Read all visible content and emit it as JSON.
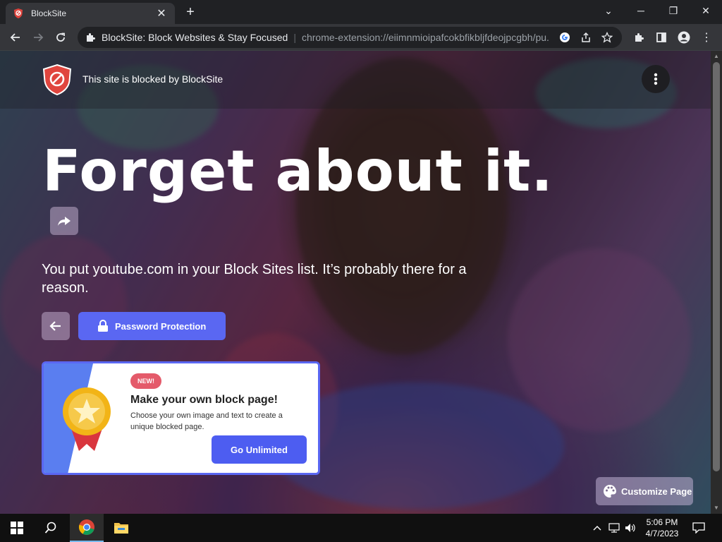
{
  "browser": {
    "tab_title": "BlockSite",
    "address_title": "BlockSite: Block Websites & Stay Focused",
    "address_url": "chrome-extension://eiimnmioipafcokbfikbljfdeojpcgbh/pu..."
  },
  "page": {
    "header_text": "This site is blocked by BlockSite",
    "headline": "Forget about it.",
    "reason": "You put youtube.com in your Block Sites list. It’s probably there for a reason.",
    "password_button_label": "Password Protection",
    "customize_button_label": "Customize Page",
    "promo": {
      "badge": "NEW!",
      "title": "Make your own block page!",
      "description": "Choose your own image and text to create a unique blocked page.",
      "button_label": "Go Unlimited"
    }
  },
  "taskbar": {
    "time": "5:06 PM",
    "date": "4/7/2023"
  },
  "colors": {
    "accent": "#5a67f2",
    "badge": "#e45a6a",
    "logo_red": "#e0453e"
  }
}
